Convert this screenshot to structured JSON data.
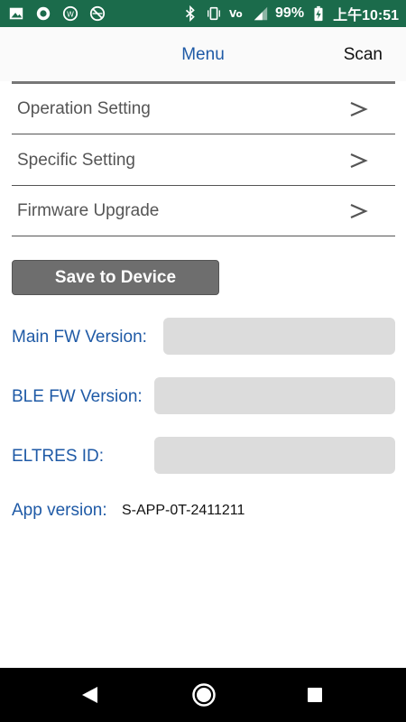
{
  "status_bar": {
    "battery_text": "99%",
    "time": "上午10:51",
    "icons": [
      "image-icon",
      "circle-app-icon",
      "w-app-icon",
      "crossed-ball-icon",
      "bluetooth-icon",
      "vibrate-icon",
      "volte-icon",
      "signal-icon",
      "battery-charging-icon"
    ]
  },
  "app_bar": {
    "title": "Menu",
    "scan_label": "Scan"
  },
  "settings": [
    {
      "label": "Operation Setting",
      "arrow": ">"
    },
    {
      "label": "Specific Setting",
      "arrow": ">"
    },
    {
      "label": "Firmware Upgrade",
      "arrow": ">"
    }
  ],
  "save_button_label": "Save to Device",
  "info": {
    "main_fw_label": "Main FW Version:",
    "main_fw_value": "",
    "ble_fw_label": "BLE FW Version:",
    "ble_fw_value": "",
    "eltres_label": "ELTRES ID:",
    "eltres_value": "",
    "app_version_label": "App version:",
    "app_version_value": "S-APP-0T-2411211"
  },
  "nav_bar": {
    "icons": [
      "back-icon",
      "home-icon",
      "recents-icon"
    ]
  },
  "colors": {
    "status_bar": "#1b6b4b",
    "accent_blue": "#1f5aa6",
    "button_gray": "#6e6e6e",
    "field_gray": "#dcdcdc"
  }
}
